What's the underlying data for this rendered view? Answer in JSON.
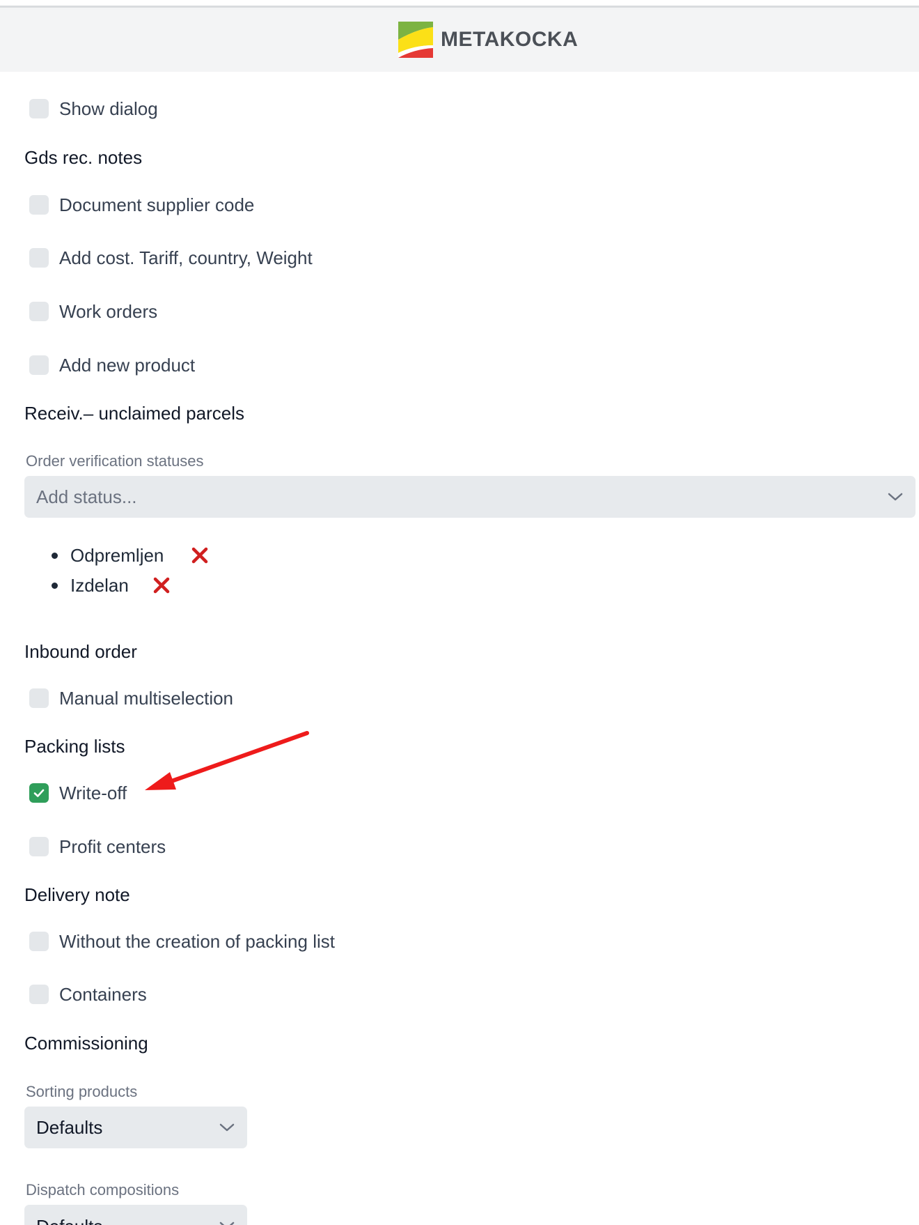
{
  "header": {
    "brand_name": "METAKOCKA",
    "logo_colors": {
      "green": "#7cb342",
      "yellow": "#fbe017",
      "red": "#e53935"
    }
  },
  "options": [
    {
      "label": "Show dialog",
      "checked": false
    },
    {
      "label": "Document supplier code",
      "checked": false
    },
    {
      "label": "Add cost. Tariff, country, Weight",
      "checked": false
    },
    {
      "label": "Work orders",
      "checked": false
    },
    {
      "label": "Add new product",
      "checked": false
    },
    {
      "label": "Manual multiselection",
      "checked": false
    },
    {
      "label": "Write-off",
      "checked": true
    },
    {
      "label": "Profit centers",
      "checked": false
    },
    {
      "label": "Without the creation of packing list",
      "checked": false
    },
    {
      "label": "Containers",
      "checked": false
    }
  ],
  "sections": {
    "gds_rec_notes": "Gds rec. notes",
    "receiv_unclaimed": "Receiv.– unclaimed parcels",
    "inbound_order": "Inbound order",
    "packing_lists": "Packing lists",
    "delivery_note": "Delivery note",
    "commissioning": "Commissioning"
  },
  "order_verification": {
    "label": "Order verification statuses",
    "placeholder": "Add status...",
    "statuses": [
      "Odpremljen",
      "Izdelan"
    ]
  },
  "sorting_products": {
    "label": "Sorting products",
    "value": "Defaults"
  },
  "dispatch_compositions": {
    "label": "Dispatch compositions",
    "value": "Defaults"
  },
  "colors": {
    "checkbox_checked": "#2f9e5a",
    "checkbox_unchecked": "#e4e7ea",
    "remove_x": "#d01f1f",
    "annotation_arrow": "#ee1b1b"
  },
  "icons": {
    "check": "check-icon",
    "chevron": "chevron-down-icon",
    "remove": "close-icon",
    "annotation": "arrow-annotation"
  }
}
